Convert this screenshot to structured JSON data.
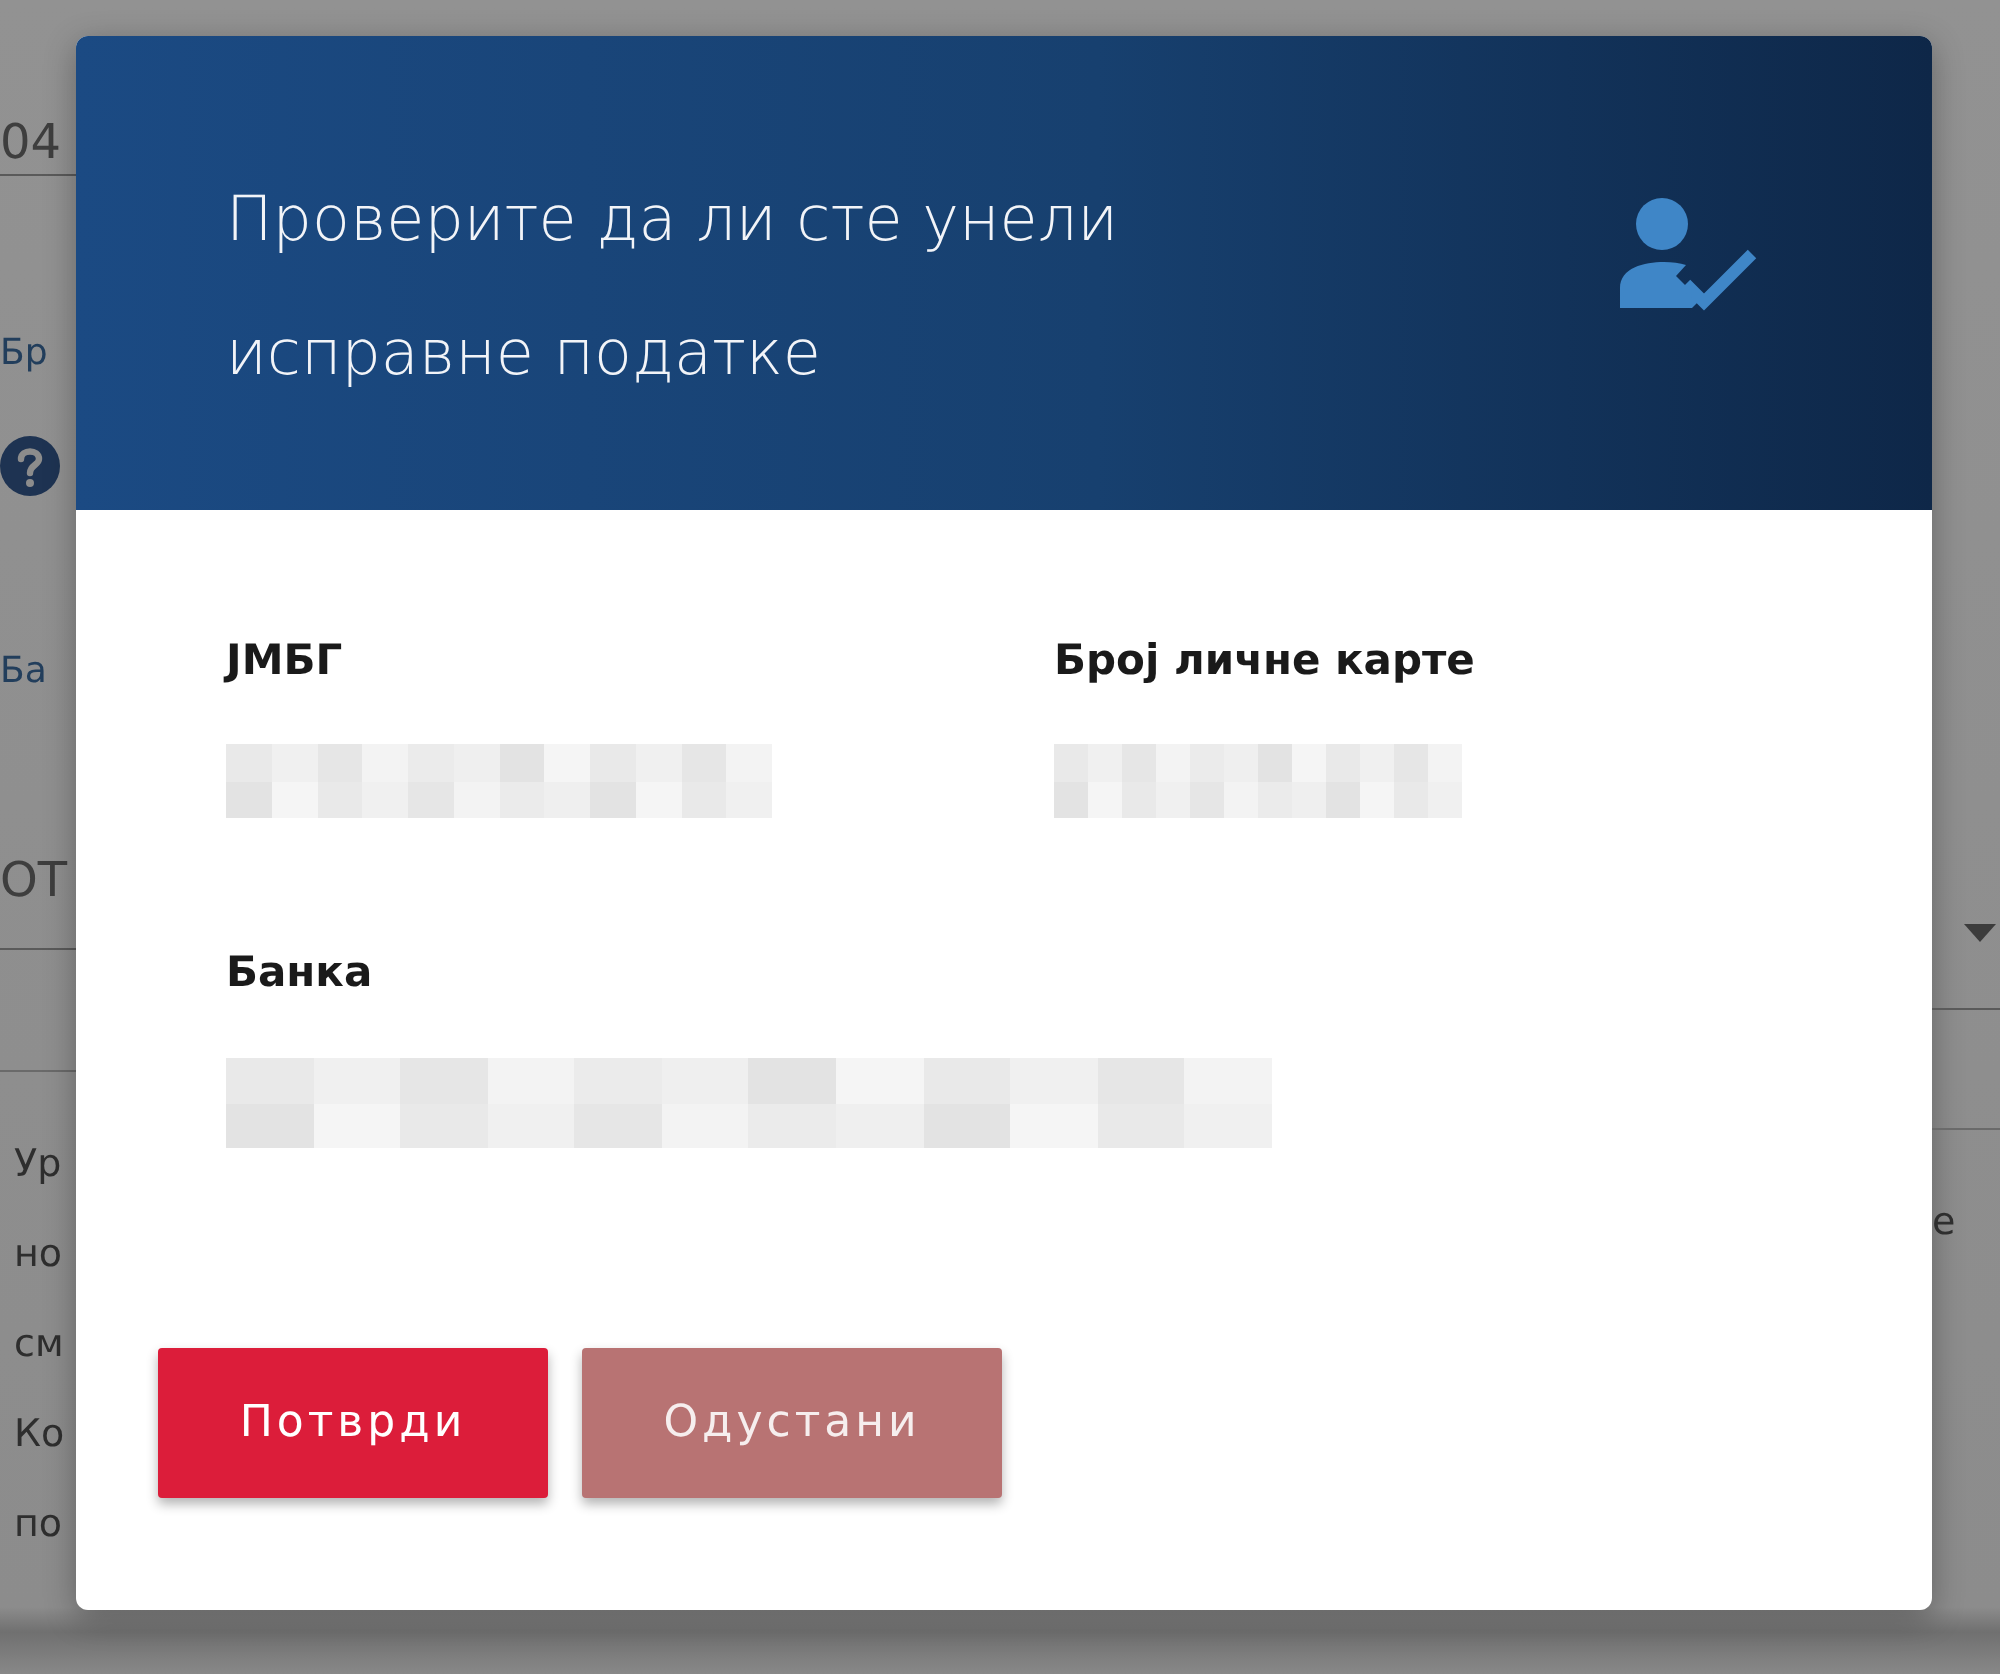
{
  "background_page": {
    "left_column": [
      {
        "kind": "value",
        "text": "04"
      },
      {
        "kind": "label",
        "text": "Бр"
      },
      {
        "kind": "help"
      },
      {
        "kind": "label",
        "text": "Ба"
      },
      {
        "kind": "select",
        "text": "ОТ"
      },
      {
        "kind": "paragraph",
        "lines": [
          "Ур",
          "но",
          "см",
          "Ко",
          "по"
        ]
      }
    ],
    "right_column": [
      {
        "kind": "select_caret"
      },
      {
        "kind": "paragraph",
        "lines": [
          "е"
        ]
      }
    ]
  },
  "dialog": {
    "title": "Проверите да ли сте унели исправне податке",
    "fields": [
      {
        "label": "ЈМБГ"
      },
      {
        "label": "Број личне карте"
      },
      {
        "label": "Банка"
      }
    ],
    "buttons": [
      {
        "label": "Потврди",
        "kind": "primary"
      },
      {
        "label": "Одустани",
        "kind": "secondary"
      }
    ]
  }
}
